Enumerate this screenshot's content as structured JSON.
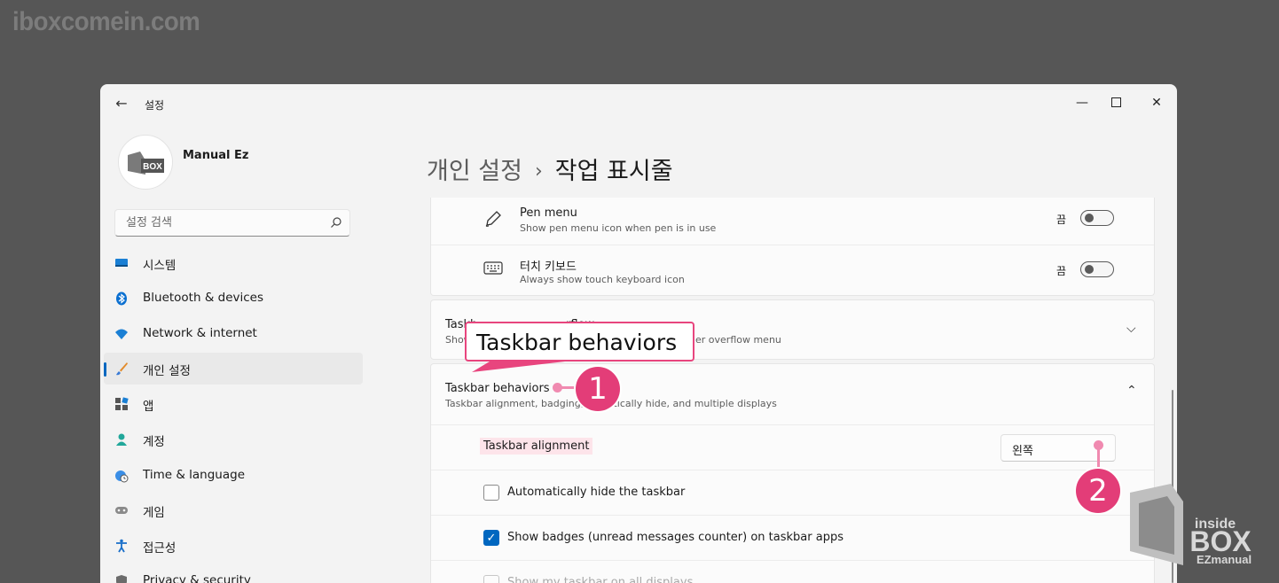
{
  "watermark": "iboxcomein.com",
  "window": {
    "title": "설정",
    "min_icon": "minimize-icon",
    "max_icon": "maximize-icon",
    "close_icon": "close-icon"
  },
  "profile": {
    "name": "Manual Ez",
    "avatar_text": "BOX"
  },
  "search": {
    "placeholder": "설정 검색"
  },
  "sidebar": {
    "items": [
      {
        "label": "시스템",
        "icon": "system-monitor-icon"
      },
      {
        "label": "Bluetooth & devices",
        "icon": "bluetooth-icon"
      },
      {
        "label": "Network & internet",
        "icon": "wifi-icon"
      },
      {
        "label": "개인 설정",
        "icon": "brush-icon",
        "selected": true
      },
      {
        "label": "앱",
        "icon": "apps-icon"
      },
      {
        "label": "계정",
        "icon": "person-icon"
      },
      {
        "label": "Time & language",
        "icon": "globe-clock-icon"
      },
      {
        "label": "게임",
        "icon": "gamepad-icon"
      },
      {
        "label": "접근성",
        "icon": "accessibility-icon"
      },
      {
        "label": "Privacy & security",
        "icon": "shield-icon"
      }
    ]
  },
  "breadcrumb": {
    "parent": "개인 설정",
    "separator": "›",
    "current": "작업 표시줄"
  },
  "settings": {
    "pen_menu": {
      "title": "Pen menu",
      "desc": "Show pen menu icon when pen is in use",
      "state": "끔"
    },
    "touch_keyboard": {
      "title": "터치 키보드",
      "desc": "Always show touch keyboard icon",
      "state": "끔"
    },
    "overflow": {
      "title": "Taskb",
      "title_tail": "rflow",
      "desc": "Show",
      "desc_tail": "er overflow menu"
    },
    "behaviors": {
      "title": "Taskbar behaviors",
      "desc": "Taskbar alignment, badging,",
      "desc_tail": "matically hide, and multiple displays"
    },
    "alignment": {
      "label": "Taskbar alignment",
      "value": "왼쪽"
    },
    "auto_hide": {
      "label": "Automatically hide the taskbar",
      "checked": false
    },
    "badges": {
      "label": "Show badges (unread messages counter) on taskbar apps",
      "checked": true
    },
    "all_displays": {
      "label": "Show my taskbar on all displays"
    }
  },
  "annotation": {
    "callout": "Taskbar behaviors",
    "step1": "1",
    "step2": "2"
  },
  "logo": {
    "line1": "inside",
    "line2": "BOX",
    "line3": "EZmanual"
  },
  "colors": {
    "accent": "#0067c0",
    "highlight": "#e33d78"
  }
}
